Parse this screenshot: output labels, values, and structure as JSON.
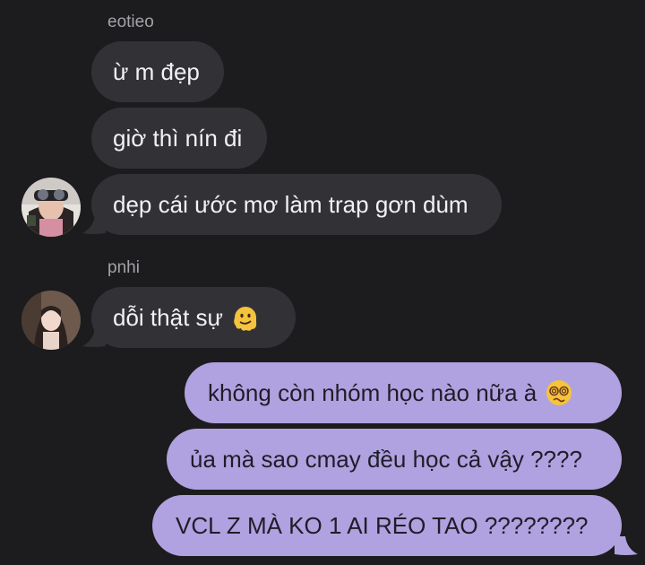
{
  "thread": {
    "sender_1": "eotieo",
    "sender_2": "pnhi",
    "messages": [
      {
        "from": "eotieo",
        "text": "ừ m đẹp"
      },
      {
        "from": "eotieo",
        "text": "giờ thì nín đi"
      },
      {
        "from": "eotieo",
        "text": "dẹp cái ước mơ làm trap gơn dùm"
      },
      {
        "from": "pnhi",
        "text": "dỗi thật sự",
        "emoji": "melting-face-emoji"
      },
      {
        "from": "me",
        "text": "không còn nhóm học nào nữa à",
        "emoji": "woozy-face-emoji"
      },
      {
        "from": "me",
        "text": "ủa mà sao cmay đều học cả vậy ????"
      },
      {
        "from": "me",
        "text": "VCL Z MÀ KO 1 AI RÉO TAO ????????"
      }
    ]
  },
  "colors": {
    "background": "#1c1c1e",
    "incoming_bubble": "#323236",
    "outgoing_bubble": "#b0a2e0"
  }
}
